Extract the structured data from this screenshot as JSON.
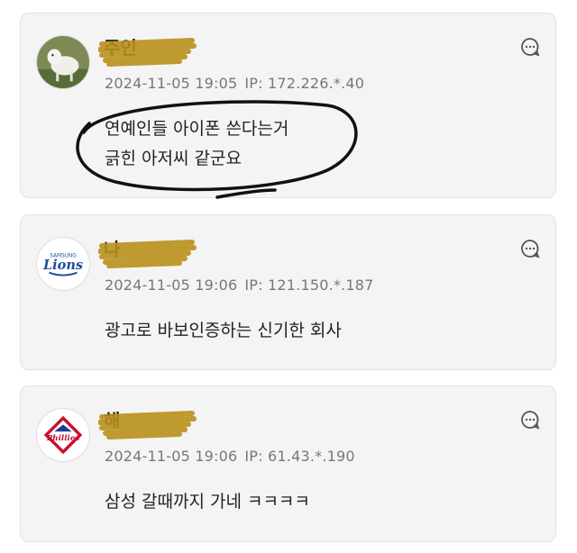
{
  "comments": [
    {
      "nickname": "주인",
      "date": "2024-11-05 19:05",
      "ip": "IP: 172.226.*.40",
      "text_lines": [
        "연예인들 아이폰 쓴다는거",
        "긁힌 아저씨 같군요"
      ],
      "avatar_icon": "goat-photo-icon"
    },
    {
      "nickname": "나",
      "date": "2024-11-05 19:06",
      "ip": "IP: 121.150.*.187",
      "text_lines": [
        "광고로 바보인증하는 신기한 회사"
      ],
      "avatar_icon": "samsung-lions-logo",
      "avatar_label": "Lions",
      "avatar_sublabel": "SAMSUNG"
    },
    {
      "nickname": "해",
      "date": "2024-11-05 19:06",
      "ip": "IP: 61.43.*.190",
      "text_lines": [
        "삼성 갈때까지 가네 ㅋㅋㅋㅋ"
      ],
      "avatar_icon": "phillies-logo",
      "avatar_label": "Phillies"
    }
  ],
  "colors": {
    "card_bg": "#f4f4f4",
    "meta_text": "#777777",
    "scribble": "#b8901c",
    "circle_mark": "#111111"
  }
}
